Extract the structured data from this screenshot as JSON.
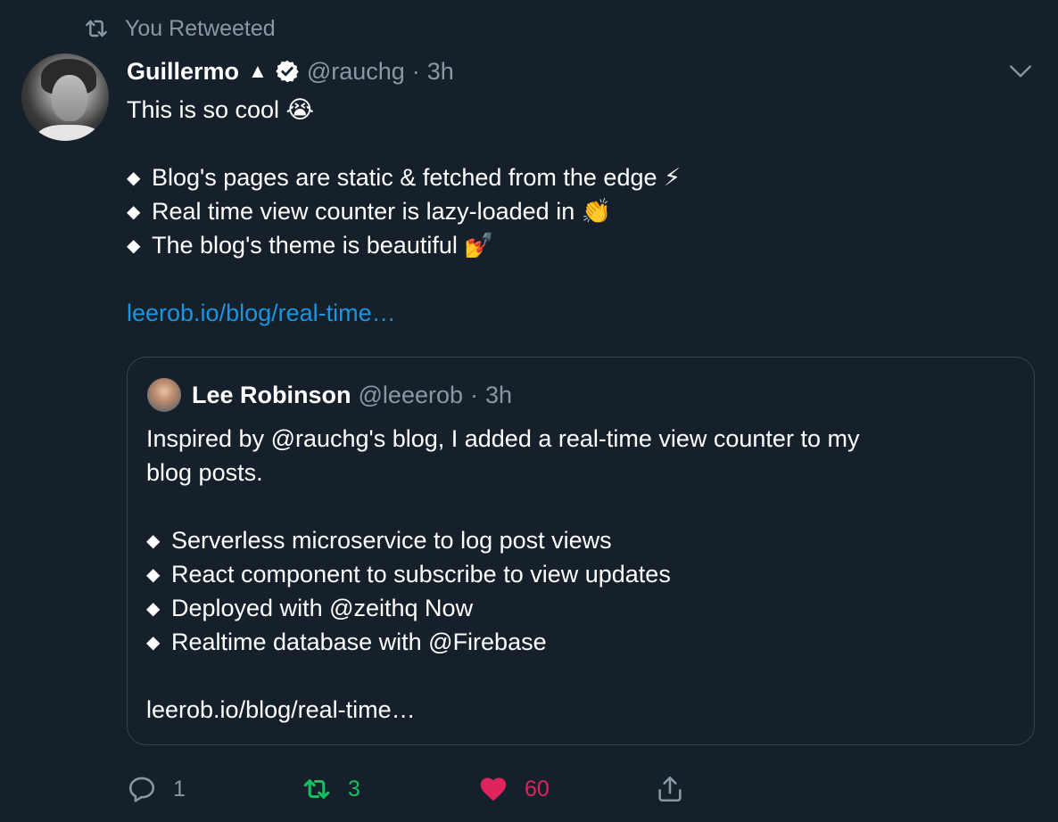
{
  "retweet_context": {
    "label": "You Retweeted",
    "icon": "retweet-icon"
  },
  "author": {
    "display_name": "Guillermo",
    "name_symbol": "▲",
    "handle": "@rauchg",
    "separator": "·",
    "time": "3h",
    "verified": true
  },
  "tweet": {
    "intro": "This is so cool 😭",
    "bullets": [
      "Blog's pages are static & fetched from the edge ⚡",
      "Real time view counter is lazy-loaded in 👏",
      "The blog's theme is beautiful 💅"
    ],
    "bullet_symbol": "◆",
    "link": "leerob.io/blog/real-time…"
  },
  "quoted": {
    "display_name": "Lee Robinson",
    "handle": "@leeerob",
    "separator": "·",
    "time": "3h",
    "line1": "Inspired by @rauchg's blog, I added a real-time view counter to my",
    "line2": "blog posts.",
    "bullets": [
      "Serverless microservice to log post views",
      "React component to subscribe to view updates",
      "Deployed with @zeithq Now",
      "Realtime database with @Firebase"
    ],
    "link": "leerob.io/blog/real-time…"
  },
  "actions": {
    "reply_count": "1",
    "retweet_count": "3",
    "like_count": "60"
  },
  "colors": {
    "background": "#15202b",
    "muted": "#8899a6",
    "link": "#1b95e0",
    "retweet_active": "#17bf63",
    "like_active": "#e0245e",
    "border": "#38444d"
  }
}
